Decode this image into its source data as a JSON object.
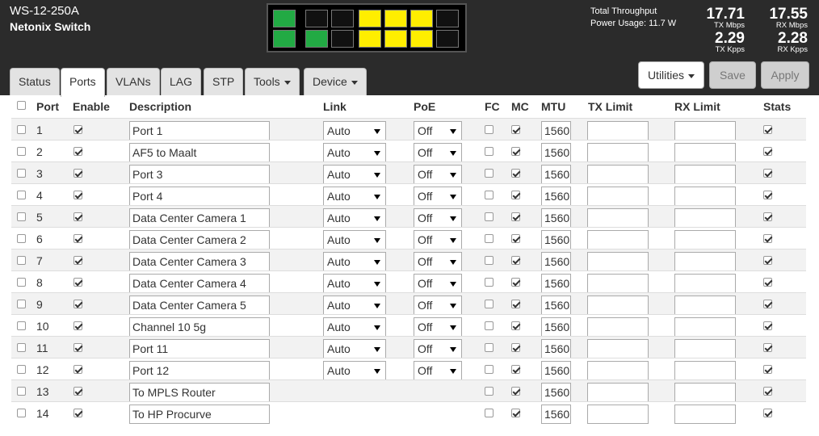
{
  "device": {
    "model": "WS-12-250A",
    "name": "Netonix Switch"
  },
  "ports_panel": {
    "top_colors": [
      "#22aa44",
      "#000000",
      "#000000",
      "#ffee00",
      "#ffee00",
      "#ffee00",
      "#000000"
    ],
    "bottom_colors": [
      "#22aa44",
      "#22aa44",
      "#000000",
      "#ffee00",
      "#ffee00",
      "#ffee00",
      "#000000"
    ]
  },
  "stats": {
    "total_throughput_label": "Total Throughput",
    "power_usage": "Power Usage: 11.7 W",
    "tx_mbps": "17.71",
    "tx_mbps_label": "TX Mbps",
    "rx_mbps": "17.55",
    "rx_mbps_label": "RX Mbps",
    "tx_kpps": "2.29",
    "tx_kpps_label": "TX Kpps",
    "rx_kpps": "2.28",
    "rx_kpps_label": "RX Kpps"
  },
  "tabs": [
    {
      "label": "Status"
    },
    {
      "label": "Ports"
    },
    {
      "label": "VLANs"
    },
    {
      "label": "LAG"
    },
    {
      "label": "STP"
    },
    {
      "label": "Tools"
    },
    {
      "label": "Device"
    }
  ],
  "buttons": {
    "utilities": "Utilities",
    "save": "Save",
    "apply": "Apply"
  },
  "columns": {
    "port": "Port",
    "enable": "Enable",
    "description": "Description",
    "link": "Link",
    "poe": "PoE",
    "fc": "FC",
    "mc": "MC",
    "mtu": "MTU",
    "tx_limit": "TX Limit",
    "rx_limit": "RX Limit",
    "stats": "Stats"
  },
  "rows": [
    {
      "port": "1",
      "description": "Port 1",
      "link": "Auto",
      "poe": "Off",
      "mtu": "1560"
    },
    {
      "port": "2",
      "description": "AF5 to Maalt",
      "link": "Auto",
      "poe": "Off",
      "mtu": "1560"
    },
    {
      "port": "3",
      "description": "Port 3",
      "link": "Auto",
      "poe": "Off",
      "mtu": "1560"
    },
    {
      "port": "4",
      "description": "Port 4",
      "link": "Auto",
      "poe": "Off",
      "mtu": "1560"
    },
    {
      "port": "5",
      "description": "Data Center Camera 1",
      "link": "Auto",
      "poe": "Off",
      "mtu": "1560"
    },
    {
      "port": "6",
      "description": "Data Center Camera 2",
      "link": "Auto",
      "poe": "Off",
      "mtu": "1560"
    },
    {
      "port": "7",
      "description": "Data Center Camera 3",
      "link": "Auto",
      "poe": "Off",
      "mtu": "1560"
    },
    {
      "port": "8",
      "description": "Data Center Camera 4",
      "link": "Auto",
      "poe": "Off",
      "mtu": "1560"
    },
    {
      "port": "9",
      "description": "Data Center Camera 5",
      "link": "Auto",
      "poe": "Off",
      "mtu": "1560"
    },
    {
      "port": "10",
      "description": "Channel 10 5g",
      "link": "Auto",
      "poe": "Off",
      "mtu": "1560"
    },
    {
      "port": "11",
      "description": "Port 11",
      "link": "Auto",
      "poe": "Off",
      "mtu": "1560"
    },
    {
      "port": "12",
      "description": "Port 12",
      "link": "Auto",
      "poe": "Off",
      "mtu": "1560"
    },
    {
      "port": "13",
      "description": "To MPLS Router",
      "link": "",
      "poe": "",
      "mtu": "1560"
    },
    {
      "port": "14",
      "description": "To HP Procurve",
      "link": "",
      "poe": "",
      "mtu": "1560"
    }
  ]
}
